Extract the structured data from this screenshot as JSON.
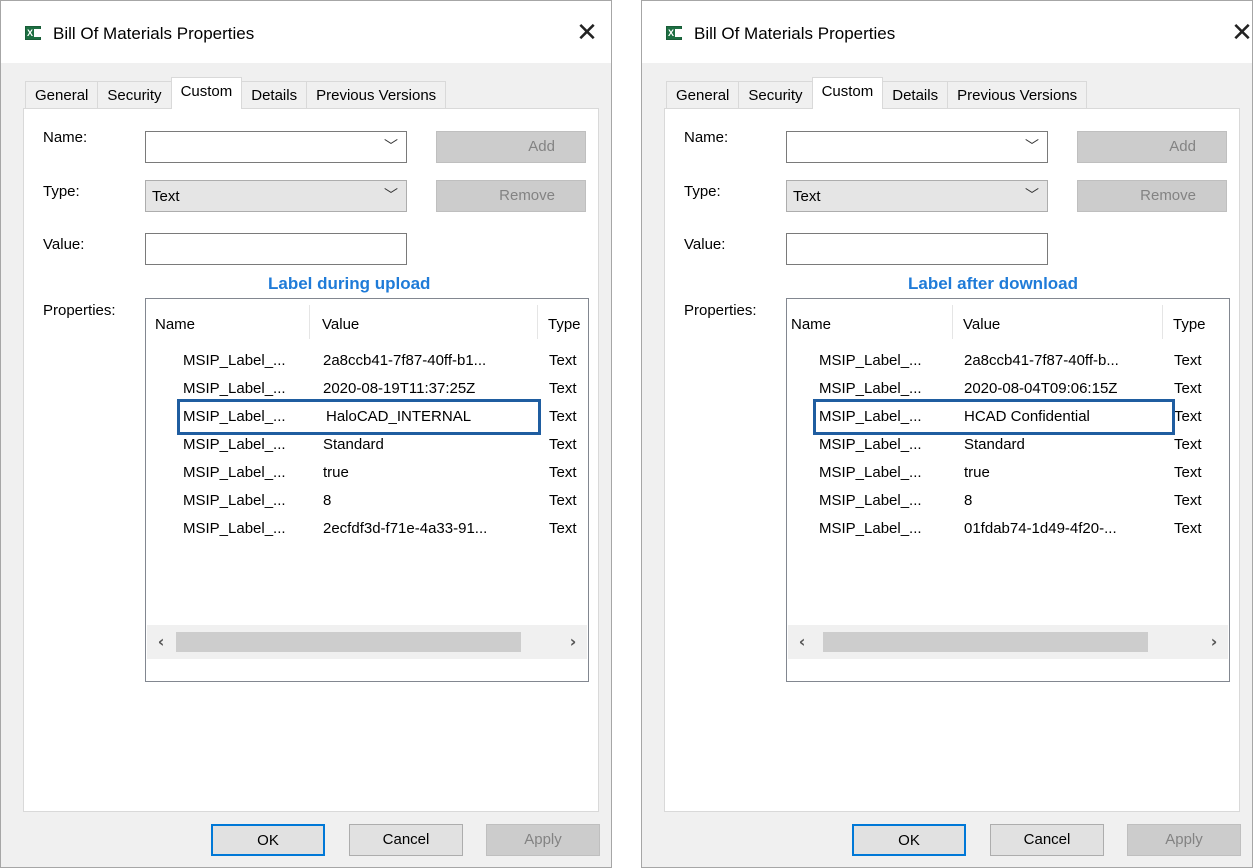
{
  "dialogs": [
    {
      "title": "Bill Of Materials Properties",
      "tabs": [
        "General",
        "Security",
        "Custom",
        "Details",
        "Previous Versions"
      ],
      "active_tab": "Custom",
      "labels": {
        "name": "Name:",
        "type": "Type:",
        "value": "Value:",
        "properties": "Properties:"
      },
      "name_value": "",
      "type_value": "Text",
      "value_value": "",
      "add_label": "Add",
      "remove_label": "Remove",
      "caption": "Label during upload",
      "columns": [
        "Name",
        "Value",
        "Type"
      ],
      "rows": [
        {
          "name": "MSIP_Label_...",
          "value": "2a8ccb41-7f87-40ff-b1...",
          "type": "Text"
        },
        {
          "name": "MSIP_Label_...",
          "value": "2020-08-19T11:37:25Z",
          "type": "Text"
        },
        {
          "name": "MSIP_Label_...",
          "value": "HaloCAD_INTERNAL",
          "type": "Text"
        },
        {
          "name": "MSIP_Label_...",
          "value": "Standard",
          "type": "Text"
        },
        {
          "name": "MSIP_Label_...",
          "value": "true",
          "type": "Text"
        },
        {
          "name": "MSIP_Label_...",
          "value": "8",
          "type": "Text"
        },
        {
          "name": "MSIP_Label_...",
          "value": "2ecfdf3d-f71e-4a33-91...",
          "type": "Text"
        }
      ],
      "ok_label": "OK",
      "cancel_label": "Cancel",
      "apply_label": "Apply"
    },
    {
      "title": "Bill Of Materials Properties",
      "tabs": [
        "General",
        "Security",
        "Custom",
        "Details",
        "Previous Versions"
      ],
      "active_tab": "Custom",
      "labels": {
        "name": "Name:",
        "type": "Type:",
        "value": "Value:",
        "properties": "Properties:"
      },
      "name_value": "",
      "type_value": "Text",
      "value_value": "",
      "add_label": "Add",
      "remove_label": "Remove",
      "caption": "Label after download",
      "columns": [
        "Name",
        "Value",
        "Type"
      ],
      "rows": [
        {
          "name": "MSIP_Label_...",
          "value": "2a8ccb41-7f87-40ff-b...",
          "type": "Text"
        },
        {
          "name": "MSIP_Label_...",
          "value": "2020-08-04T09:06:15Z",
          "type": "Text"
        },
        {
          "name": "MSIP_Label_...",
          "value": "HCAD Confidential",
          "type": "Text"
        },
        {
          "name": "MSIP_Label_...",
          "value": "Standard",
          "type": "Text"
        },
        {
          "name": "MSIP_Label_...",
          "value": "true",
          "type": "Text"
        },
        {
          "name": "MSIP_Label_...",
          "value": "8",
          "type": "Text"
        },
        {
          "name": "MSIP_Label_...",
          "value": "01fdab74-1d49-4f20-...",
          "type": "Text"
        }
      ],
      "ok_label": "OK",
      "cancel_label": "Cancel",
      "apply_label": "Apply"
    }
  ],
  "colors": {
    "caption": "#1f7bd8",
    "highlight_box": "#1f5da0",
    "ok_border": "#0078d7"
  }
}
